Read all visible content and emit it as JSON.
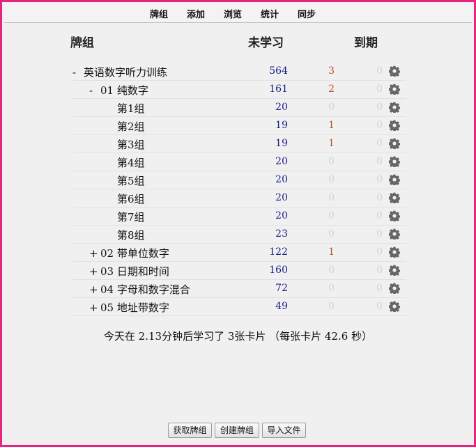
{
  "toolbar": {
    "decks": "牌组",
    "add": "添加",
    "browse": "浏览",
    "stats": "统计",
    "sync": "同步"
  },
  "headers": {
    "deck": "牌组",
    "new": "未学习",
    "due": "到期"
  },
  "decks": [
    {
      "toggle": "-",
      "name": "英语数字听力训练",
      "new": "564",
      "learn": "3",
      "due": "0",
      "level": 0
    },
    {
      "toggle": "-",
      "name": "01 纯数字",
      "new": "161",
      "learn": "2",
      "due": "0",
      "level": 1
    },
    {
      "toggle": "",
      "name": "第1组",
      "new": "20",
      "learn": "0",
      "due": "0",
      "level": 2
    },
    {
      "toggle": "",
      "name": "第2组",
      "new": "19",
      "learn": "1",
      "due": "0",
      "level": 2
    },
    {
      "toggle": "",
      "name": "第3组",
      "new": "19",
      "learn": "1",
      "due": "0",
      "level": 2
    },
    {
      "toggle": "",
      "name": "第4组",
      "new": "20",
      "learn": "0",
      "due": "0",
      "level": 2
    },
    {
      "toggle": "",
      "name": "第5组",
      "new": "20",
      "learn": "0",
      "due": "0",
      "level": 2
    },
    {
      "toggle": "",
      "name": "第6组",
      "new": "20",
      "learn": "0",
      "due": "0",
      "level": 2
    },
    {
      "toggle": "",
      "name": "第7组",
      "new": "20",
      "learn": "0",
      "due": "0",
      "level": 2
    },
    {
      "toggle": "",
      "name": "第8组",
      "new": "23",
      "learn": "0",
      "due": "0",
      "level": 2
    },
    {
      "toggle": "+",
      "name": "02 带单位数字",
      "new": "122",
      "learn": "1",
      "due": "0",
      "level": 1
    },
    {
      "toggle": "+",
      "name": "03 日期和时间",
      "new": "160",
      "learn": "0",
      "due": "0",
      "level": 1
    },
    {
      "toggle": "+",
      "name": "04 字母和数字混合",
      "new": "72",
      "learn": "0",
      "due": "0",
      "level": 1
    },
    {
      "toggle": "+",
      "name": "05 地址带数字",
      "new": "49",
      "learn": "0",
      "due": "0",
      "level": 1
    }
  ],
  "summary": "今天在 2.13分钟后学习了 3张卡片 （每张卡片 42.6 秒）",
  "buttons": {
    "get_shared": "获取牌组",
    "create_deck": "创建牌组",
    "import_file": "导入文件"
  },
  "colors": {
    "frame": "#e8257e",
    "new_count": "#1a1a8c",
    "learn_count": "#b8522a",
    "zero_count": "#d2d2d2"
  }
}
